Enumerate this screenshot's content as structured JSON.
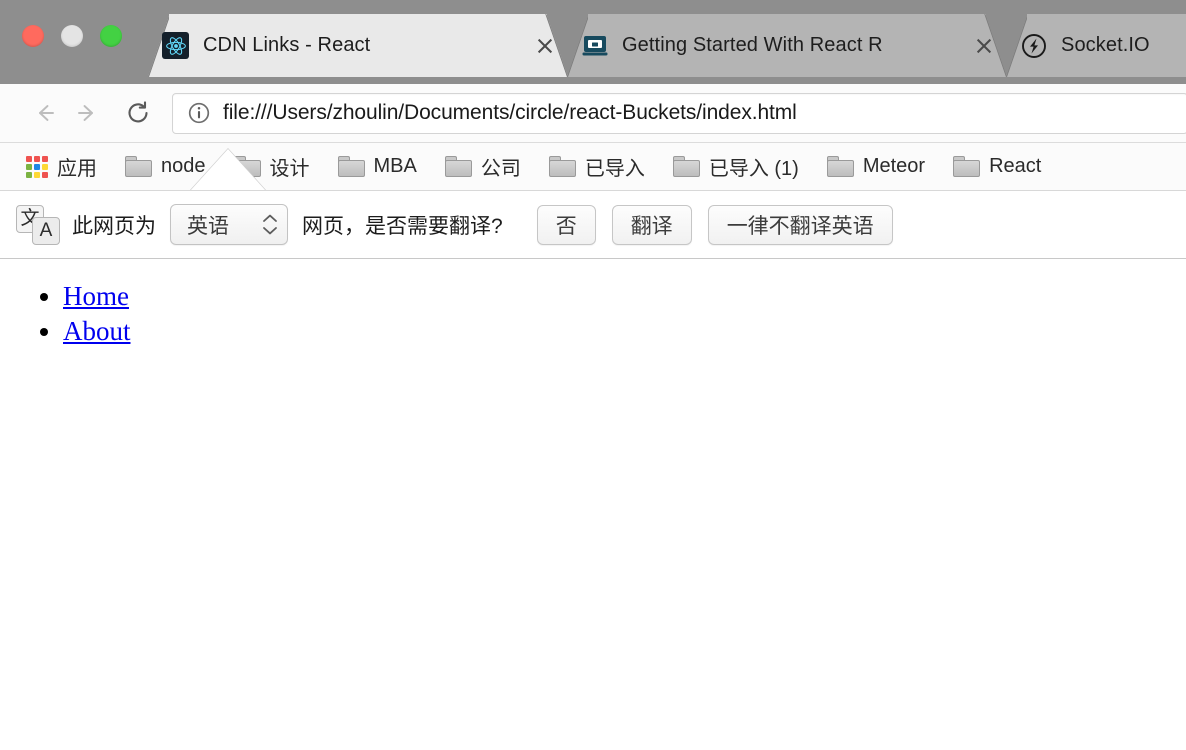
{
  "window": {
    "traffic_lights": [
      "close",
      "minimize",
      "zoom"
    ]
  },
  "tabstrip": {
    "tabs": [
      {
        "title": "CDN Links - React",
        "favicon": "react-icon",
        "active": true,
        "close_label": "×"
      },
      {
        "title": "Getting Started With React R",
        "favicon": "laptop-icon",
        "active": false,
        "close_label": "×"
      },
      {
        "title": "Socket.IO",
        "favicon": "lightning-icon",
        "active": false,
        "close_label": "×"
      }
    ]
  },
  "toolbar": {
    "back_label": "←",
    "forward_label": "→",
    "reload_label": "⟳",
    "site_info_label": "ⓘ",
    "url": "file:///Users/zhoulin/Documents/circle/react-Buckets/index.html"
  },
  "bookmarks": {
    "items": [
      {
        "label": "应用",
        "icon": "apps-grid-icon"
      },
      {
        "label": "node",
        "icon": "folder-icon"
      },
      {
        "label": "设计",
        "icon": "folder-icon"
      },
      {
        "label": "MBA",
        "icon": "folder-icon"
      },
      {
        "label": "公司",
        "icon": "folder-icon"
      },
      {
        "label": "已导入",
        "icon": "folder-icon"
      },
      {
        "label": "已导入 (1)",
        "icon": "folder-icon"
      },
      {
        "label": "Meteor",
        "icon": "folder-icon"
      },
      {
        "label": "React",
        "icon": "folder-icon"
      }
    ]
  },
  "translate_bar": {
    "icon": "translate-icon",
    "icon_glyph_primary": "文",
    "icon_glyph_secondary": "A",
    "prefix_text": "此网页为",
    "selected_language": "英语",
    "suffix_text": "网页，是否需要翻译?",
    "buttons": [
      {
        "label": "否",
        "name": "decline-translate-button"
      },
      {
        "label": "翻译",
        "name": "translate-button"
      },
      {
        "label": "一律不翻译英语",
        "name": "never-translate-english-button"
      }
    ]
  },
  "page": {
    "links": [
      {
        "label": "Home"
      },
      {
        "label": "About"
      }
    ]
  },
  "colors": {
    "tabstrip_bg": "#8e8e8e",
    "active_tab": "#e9e9e9",
    "inactive_tab": "#b4b4b4",
    "link": "#0000ee",
    "react_navy": "#14202b",
    "react_cyan": "#61dafb",
    "laptop_teal": "#174a5e",
    "traffic_red": "#ff6a5e",
    "traffic_yellow": "#e4e4e4",
    "traffic_green": "#43d143"
  }
}
